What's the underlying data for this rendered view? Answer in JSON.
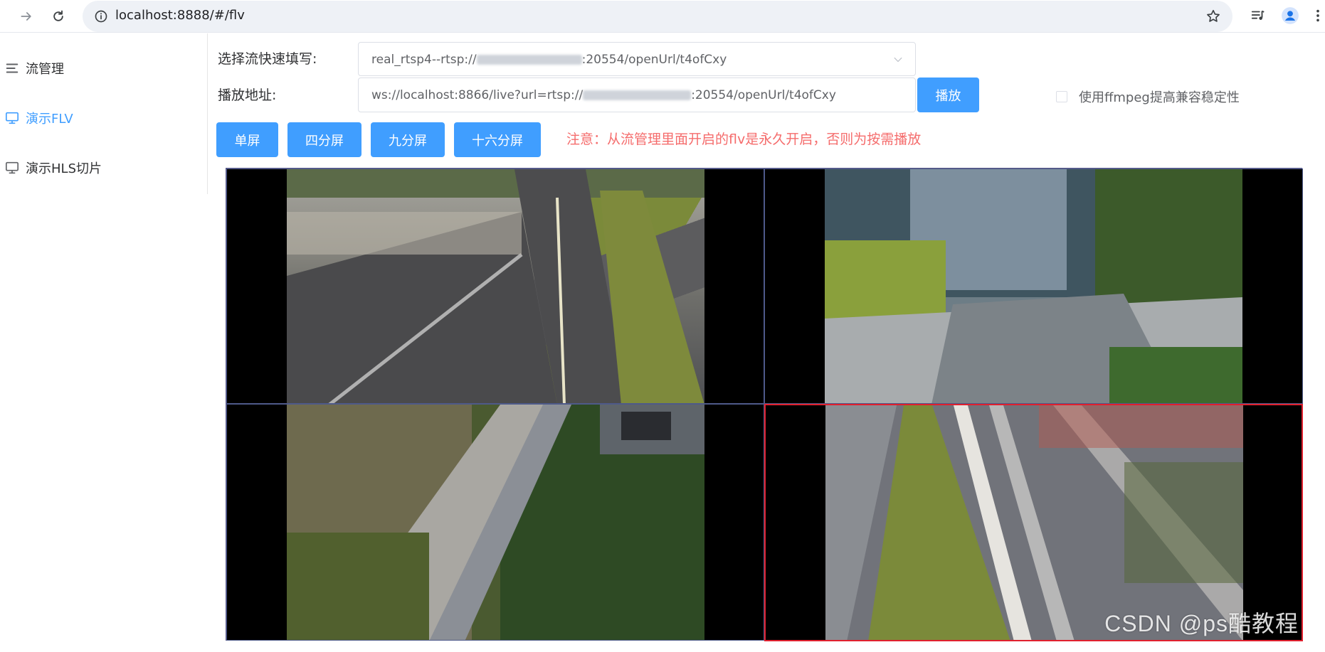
{
  "browser": {
    "url": "localhost:8888/#/flv",
    "back_icon": "arrow-right-icon",
    "reload_icon": "reload-icon"
  },
  "sidebar": {
    "items": [
      {
        "label": "流管理",
        "icon": "list-icon",
        "active": false
      },
      {
        "label": "演示FLV",
        "icon": "monitor-icon",
        "active": true
      },
      {
        "label": "演示HLS切片",
        "icon": "monitor-icon",
        "active": false
      }
    ]
  },
  "form": {
    "select_label": "选择流快速填写:",
    "select_value_prefix": "real_rtsp4--rtsp://",
    "select_value_suffix": ":20554/openUrl/t4ofCxy",
    "address_label": "播放地址:",
    "address_value_prefix": "ws://localhost:8866/live?url=rtsp://",
    "address_value_suffix": ":20554/openUrl/t4ofCxy",
    "play_button": "播放",
    "ffmpeg_checkbox_label": "使用ffmpeg提高兼容稳定性",
    "ffmpeg_checked": false
  },
  "layout_buttons": [
    "单屏",
    "四分屏",
    "九分屏",
    "十六分屏"
  ],
  "notice": "注意：从流管理里面开启的flv是永久开启，否则为按需播放",
  "players": {
    "count": 4,
    "active_index": 3
  },
  "watermark": "CSDN @ps酷教程",
  "colors": {
    "primary": "#409eff",
    "notice": "#f56c6c",
    "active_border": "#e0202e"
  }
}
